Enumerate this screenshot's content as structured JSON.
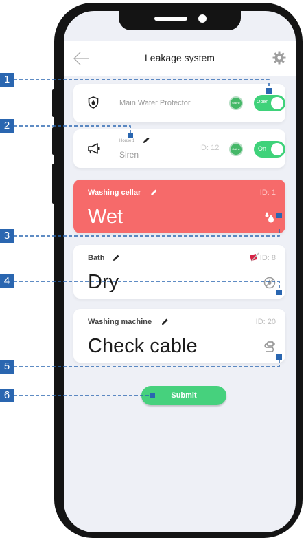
{
  "header": {
    "title": "Leakage system"
  },
  "devices": {
    "protector": {
      "name": "Main Water Protector",
      "online": "Online",
      "toggle": "Open"
    },
    "siren": {
      "house": "House 1",
      "name": "Siren",
      "id": "ID: 12",
      "online": "Online",
      "toggle": "On"
    }
  },
  "zones": [
    {
      "name": "Washing cellar",
      "id": "ID: 1",
      "status": "Wet",
      "icon": "water-drops-icon"
    },
    {
      "name": "Bath",
      "id": "ID: 8",
      "status": "Dry",
      "icon": "no-water-icon"
    },
    {
      "name": "Washing machine",
      "id": "ID: 20",
      "status": "Check cable",
      "icon": "cable-plug-icon"
    }
  ],
  "submit": {
    "label": "Submit"
  },
  "callouts": [
    "1",
    "2",
    "3",
    "4",
    "5",
    "6"
  ],
  "colors": {
    "wet": "#f66a6a",
    "toggle": "#3fd27a",
    "online": "#45b868",
    "submit": "#46d17d",
    "callout": "#2a66b0"
  }
}
